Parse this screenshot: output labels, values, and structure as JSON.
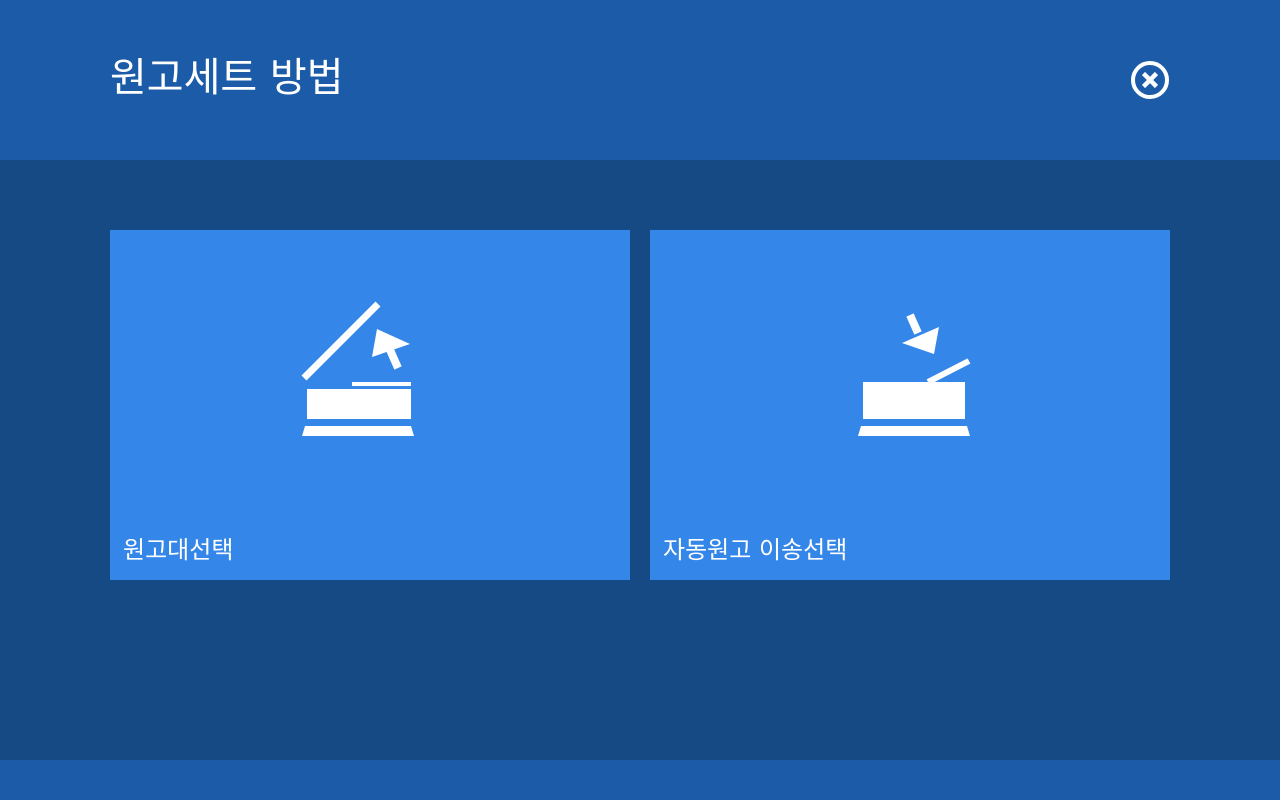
{
  "header": {
    "title": "원고세트 방법",
    "close_icon": "close-circle-icon"
  },
  "options": [
    {
      "label": "원고대선택",
      "icon": "scanner-lid-open-icon"
    },
    {
      "label": "자동원고 이송선택",
      "icon": "document-feeder-icon"
    }
  ],
  "colors": {
    "header_bg": "#1b5ba7",
    "main_bg": "#164a85",
    "tile_bg": "#3486e8",
    "text": "#ffffff"
  }
}
